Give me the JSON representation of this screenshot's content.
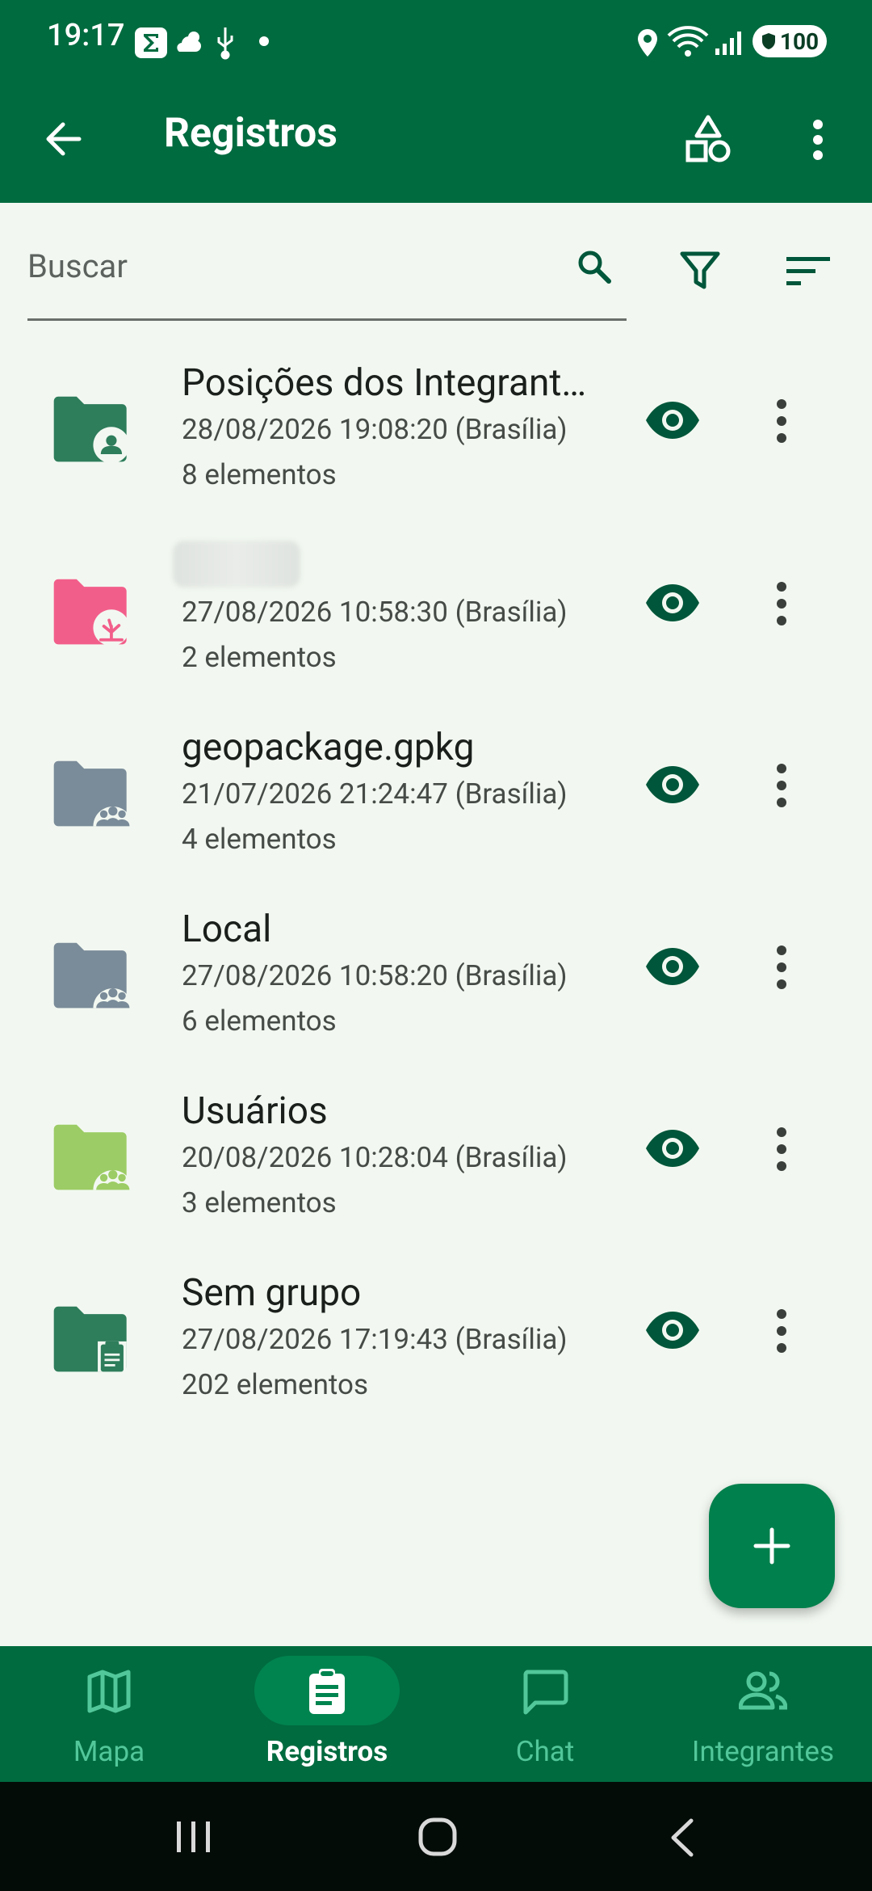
{
  "status_bar": {
    "time": "19:17",
    "battery": "100"
  },
  "app_bar": {
    "title": "Registros"
  },
  "search": {
    "placeholder": "Buscar"
  },
  "colors": {
    "primary": "#006b3f",
    "background": "#f2f8f1",
    "fab": "#00804c"
  },
  "records": [
    {
      "title": "Posições dos Integrantes",
      "date": "28/08/2026 19:08:20 (Brasília)",
      "count": "8 elementos",
      "icon": "folder-person-icon",
      "color": "#2e7d5b"
    },
    {
      "title": "",
      "date": "27/08/2026 10:58:30 (Brasília)",
      "count": "2 elementos",
      "icon": "folder-plant-icon",
      "color": "#f25e8a"
    },
    {
      "title": "geopackage.gpkg",
      "date": "21/07/2026 21:24:47 (Brasília)",
      "count": "4 elementos",
      "icon": "folder-group-icon",
      "color": "#7a8b99"
    },
    {
      "title": "Local",
      "date": "27/08/2026 10:58:20 (Brasília)",
      "count": "6 elementos",
      "icon": "folder-group-icon",
      "color": "#7a8b99"
    },
    {
      "title": "Usuários",
      "date": "20/08/2026 10:28:04 (Brasília)",
      "count": "3 elementos",
      "icon": "folder-group-icon",
      "color": "#9ccc65"
    },
    {
      "title": "Sem grupo",
      "date": "27/08/2026 17:19:43 (Brasília)",
      "count": "202 elementos",
      "icon": "folder-clipboard-icon",
      "color": "#2e7d5b"
    }
  ],
  "nav": {
    "items": [
      {
        "label": "Mapa",
        "icon": "map-icon",
        "active": false
      },
      {
        "label": "Registros",
        "icon": "clipboard-icon",
        "active": true
      },
      {
        "label": "Chat",
        "icon": "chat-icon",
        "active": false
      },
      {
        "label": "Integrantes",
        "icon": "people-icon",
        "active": false
      }
    ]
  }
}
